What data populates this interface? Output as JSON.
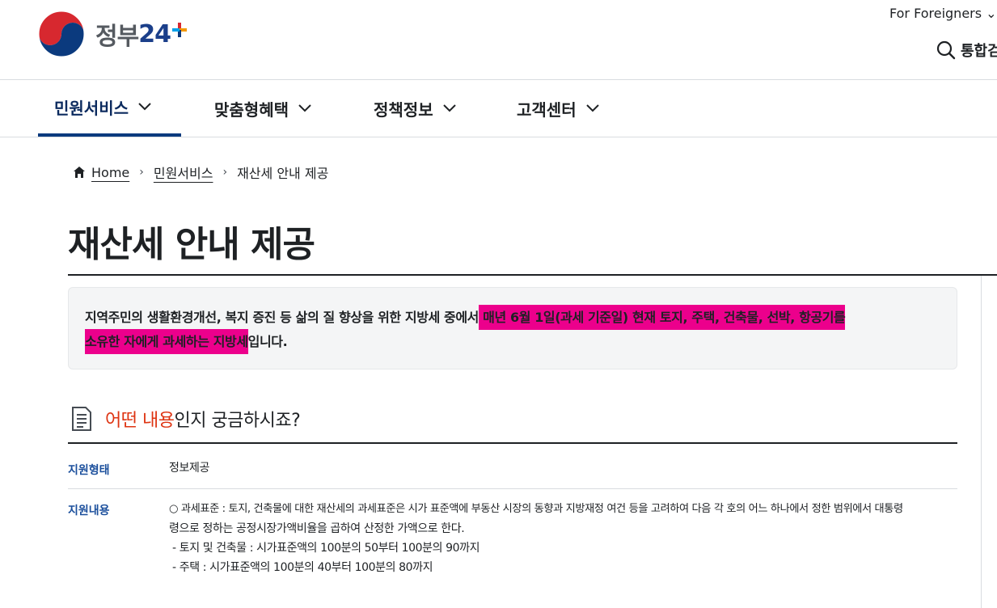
{
  "header": {
    "logo_text_ko": "정부",
    "logo_text_num": "24",
    "foreigners_label": "For Foreigners",
    "foreigners_chevron": "⌄",
    "search_label": "통합검"
  },
  "nav": {
    "items": [
      {
        "label": "민원서비스",
        "active": true
      },
      {
        "label": "맞춤형혜택",
        "active": false
      },
      {
        "label": "정책정보",
        "active": false
      },
      {
        "label": "고객센터",
        "active": false
      }
    ]
  },
  "breadcrumb": {
    "home": "Home",
    "level1": "민원서비스",
    "current": "재산세 안내 제공",
    "separator": "›"
  },
  "page": {
    "title": "재산세 안내 제공"
  },
  "summary": {
    "part1": "지역주민의 생활환경개선, 복지 증진 등 삶의 질 향상을 위한 지방세 중에서",
    "highlight1": " 매년 6월 1일(과세 기준일) 현재 토지, 주택, 건축물, 선박, 항공기를",
    "highlight2": "소유한 자에게 과세하는 지방세",
    "part2": "입니다.",
    "highlight_color": "#ec008c"
  },
  "section": {
    "title_accent": "어떤 내용",
    "title_rest": "인지 궁금하시죠?",
    "accent_color": "#de3412",
    "rows": [
      {
        "label": "지원형태",
        "value": "정보제공"
      },
      {
        "label": "지원내용",
        "lines": [
          "○ 과세표준 : 토지, 건축물에 대한 재산세의 과세표준은 시가 표준액에 부동산 시장의 동향과 지방재정 여건 등을 고려하여 다음 각 호의 어느 하나에서 정한 범위에서 대통령",
          "령으로 정하는 공정시장가액비율을 곱하여 산정한 가액으로 한다.",
          " - 토지 및 건축물 : 시가표준액의 100분의 50부터 100분의 90까지",
          " - 주택 : 시가표준액의 100분의 40부터 100분의 80까지"
        ]
      }
    ]
  },
  "colors": {
    "nav_active": "#0b3a7e",
    "label_blue": "#1b4f9c"
  }
}
